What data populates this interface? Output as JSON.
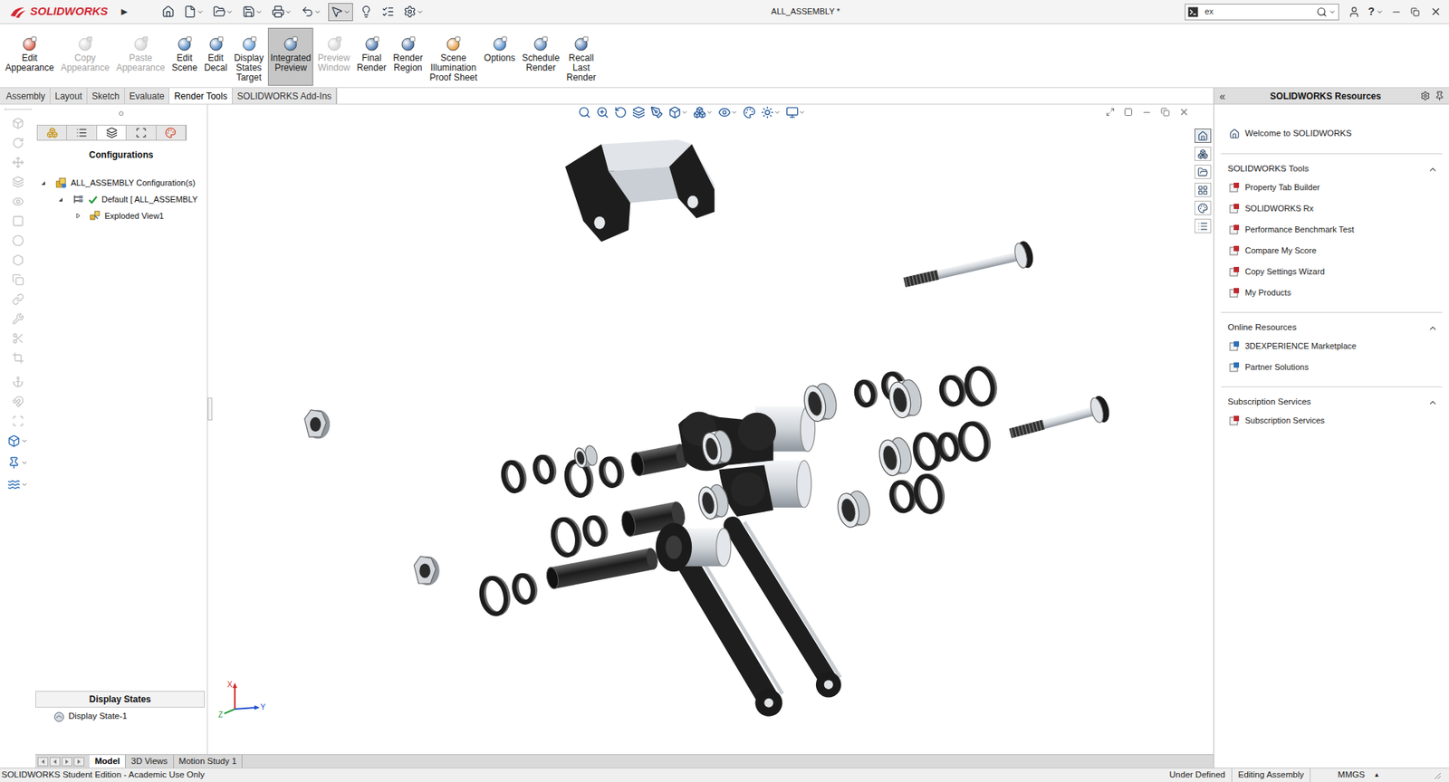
{
  "window": {
    "app": "SOLIDWORKS",
    "menu_arrow": "▶",
    "title": "ALL_ASSEMBLY *",
    "help": "?"
  },
  "quick_access": [
    {
      "selected": false
    },
    {
      "selected": false
    },
    {
      "selected": false
    },
    {
      "selected": false
    },
    {
      "selected": false
    },
    {
      "selected": false
    },
    {
      "selected": true
    },
    {
      "selected": false
    },
    {
      "selected": false
    },
    {
      "selected": false
    }
  ],
  "search": {
    "value": "ex"
  },
  "ribbon": [
    {
      "label": [
        "Edit",
        "Appearance"
      ],
      "disabled": false,
      "selected": false
    },
    {
      "label": [
        "Copy",
        "Appearance"
      ],
      "disabled": true,
      "selected": false
    },
    {
      "label": [
        "Paste",
        "Appearance"
      ],
      "disabled": true,
      "selected": false
    },
    {
      "label": [
        "Edit",
        "Scene"
      ],
      "disabled": false,
      "selected": false
    },
    {
      "label": [
        "Edit",
        "Decal"
      ],
      "disabled": false,
      "selected": false
    },
    {
      "label": [
        "Display",
        "States",
        "Target"
      ],
      "disabled": false,
      "selected": false
    },
    {
      "label": [
        "Integrated",
        "Preview"
      ],
      "disabled": false,
      "selected": true
    },
    {
      "label": [
        "Preview",
        "Window"
      ],
      "disabled": true,
      "selected": false
    },
    {
      "label": [
        "Final",
        "Render"
      ],
      "disabled": false,
      "selected": false
    },
    {
      "label": [
        "Render",
        "Region"
      ],
      "disabled": false,
      "selected": false
    },
    {
      "label": [
        "Scene",
        "Illumination",
        "Proof Sheet"
      ],
      "disabled": false,
      "selected": false
    },
    {
      "label": [
        "Options"
      ],
      "disabled": false,
      "selected": false
    },
    {
      "label": [
        "Schedule",
        "Render"
      ],
      "disabled": false,
      "selected": false
    },
    {
      "label": [
        "Recall",
        "Last",
        "Render"
      ],
      "disabled": false,
      "selected": false
    }
  ],
  "tabs": [
    {
      "label": "Assembly",
      "selected": false
    },
    {
      "label": "Layout",
      "selected": false
    },
    {
      "label": "Sketch",
      "selected": false
    },
    {
      "label": "Evaluate",
      "selected": false
    },
    {
      "label": "Render Tools",
      "selected": true
    },
    {
      "label": "SOLIDWORKS Add-Ins",
      "selected": false
    }
  ],
  "feature_manager": {
    "tabs": [
      {
        "selected": false
      },
      {
        "selected": false
      },
      {
        "selected": true
      },
      {
        "selected": false
      },
      {
        "selected": false
      }
    ],
    "title": "Configurations",
    "tree": [
      {
        "label": "ALL_ASSEMBLY Configuration(s)",
        "level": 0,
        "expanded": true,
        "checked": false
      },
      {
        "label": "Default [ ALL_ASSEMBLY",
        "level": 1,
        "expanded": true,
        "checked": true
      },
      {
        "label": "Exploded View1",
        "level": 2,
        "expanded": false,
        "checked": false
      }
    ],
    "display_states": {
      "title": "Display States",
      "items": [
        "Display State-1"
      ]
    }
  },
  "triad": [
    "X",
    "Y",
    "Z"
  ],
  "task_tabs": [
    {
      "selected": true
    },
    {
      "selected": false
    },
    {
      "selected": false
    },
    {
      "selected": false
    },
    {
      "selected": false
    },
    {
      "selected": false
    }
  ],
  "bottom_tabs": [
    {
      "label": "Model",
      "selected": true
    },
    {
      "label": "3D Views",
      "selected": false
    },
    {
      "label": "Motion Study 1",
      "selected": false
    }
  ],
  "task_pane": {
    "collapse": "«",
    "title": "SOLIDWORKS Resources",
    "welcome": "Welcome to SOLIDWORKS",
    "sections": [
      {
        "title": "SOLIDWORKS Tools",
        "expanded": true,
        "items": [
          "Property Tab Builder",
          "SOLIDWORKS Rx",
          "Performance Benchmark Test",
          "Compare My Score",
          "Copy Settings Wizard",
          "My Products"
        ]
      },
      {
        "title": "Online Resources",
        "expanded": true,
        "items": [
          "3DEXPERIENCE Marketplace",
          "Partner Solutions"
        ]
      },
      {
        "title": "Subscription Services",
        "expanded": true,
        "items": [
          "Subscription Services"
        ]
      }
    ]
  },
  "status_bar": {
    "edition": "SOLIDWORKS Student Edition - Academic Use Only",
    "items": [
      "Under Defined",
      "Editing Assembly",
      "MMGS"
    ],
    "units_arrow": "▲"
  }
}
